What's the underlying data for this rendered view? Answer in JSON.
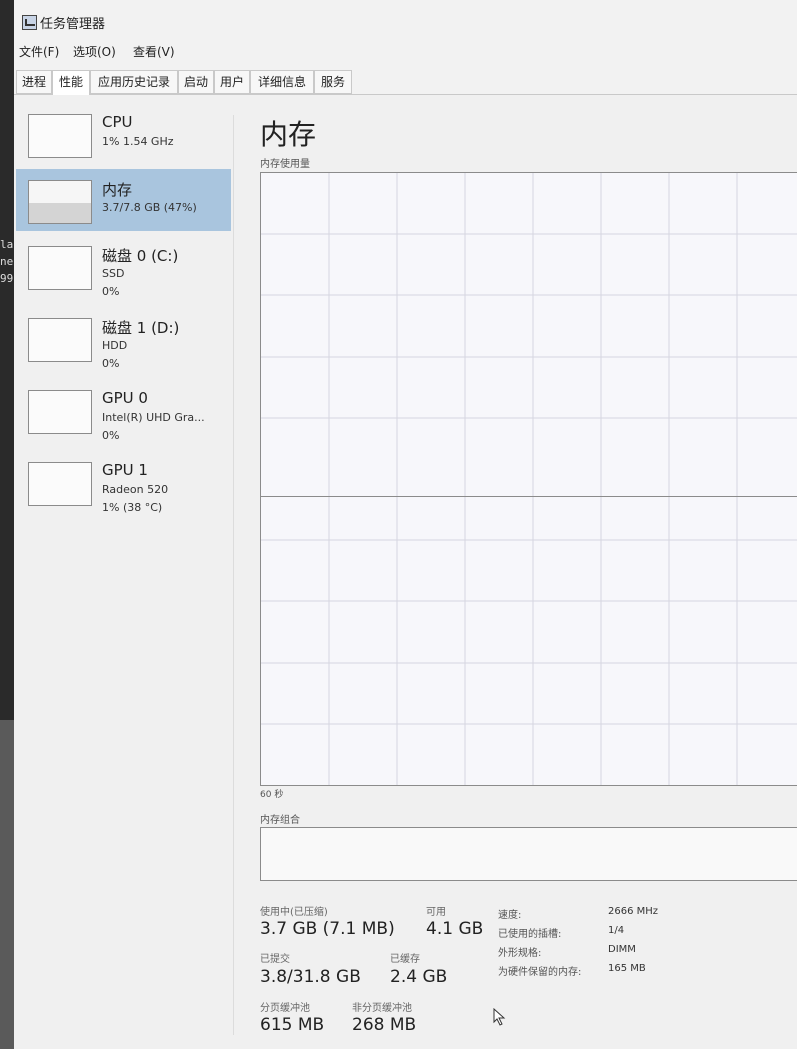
{
  "window": {
    "title": "任务管理器"
  },
  "menu": [
    "文件(F)",
    "选项(O)",
    "查看(V)"
  ],
  "tabs": [
    "进程",
    "性能",
    "应用历史记录",
    "启动",
    "用户",
    "详细信息",
    "服务"
  ],
  "active_tab": "性能",
  "sidebar": {
    "items": [
      {
        "name": "CPU",
        "line1": "1% 1.54 GHz",
        "line2": ""
      },
      {
        "name": "内存",
        "line1": "3.7/7.8 GB (47%)",
        "line2": "",
        "selected": true,
        "fill_fraction": 0.47
      },
      {
        "name": "磁盘 0 (C:)",
        "line1": "SSD",
        "line2": "0%"
      },
      {
        "name": "磁盘 1 (D:)",
        "line1": "HDD",
        "line2": "0%"
      },
      {
        "name": "GPU 0",
        "line1": "Intel(R) UHD Gra...",
        "line2": "0%"
      },
      {
        "name": "GPU 1",
        "line1": "Radeon 520",
        "line2": "1% (38 °C)"
      }
    ]
  },
  "main": {
    "title": "内存",
    "graph_label": "内存使用量",
    "axis_label": "60 秒",
    "composition_label": "内存组合",
    "stats": {
      "in_use_label": "使用中(已压缩)",
      "in_use_value": "3.7 GB (7.1 MB)",
      "available_label": "可用",
      "available_value": "4.1 GB",
      "committed_label": "已提交",
      "committed_value": "3.8/31.8 GB",
      "cached_label": "已缓存",
      "cached_value": "2.4 GB",
      "paged_label": "分页缓冲池",
      "paged_value": "615 MB",
      "nonpaged_label": "非分页缓冲池",
      "nonpaged_value": "268 MB"
    },
    "details": [
      {
        "label": "速度:",
        "value": "2666 MHz"
      },
      {
        "label": "已使用的插槽:",
        "value": "1/4"
      },
      {
        "label": "外形规格:",
        "value": "DIMM"
      },
      {
        "label": "为硬件保留的内存:",
        "value": "165 MB"
      }
    ]
  },
  "background_text": [
    "la",
    "ne",
    "99"
  ],
  "colors": {
    "selected_bg": "#a9c5de",
    "graph_border": "#8b8b8b",
    "grid": "#d6d6e0"
  }
}
